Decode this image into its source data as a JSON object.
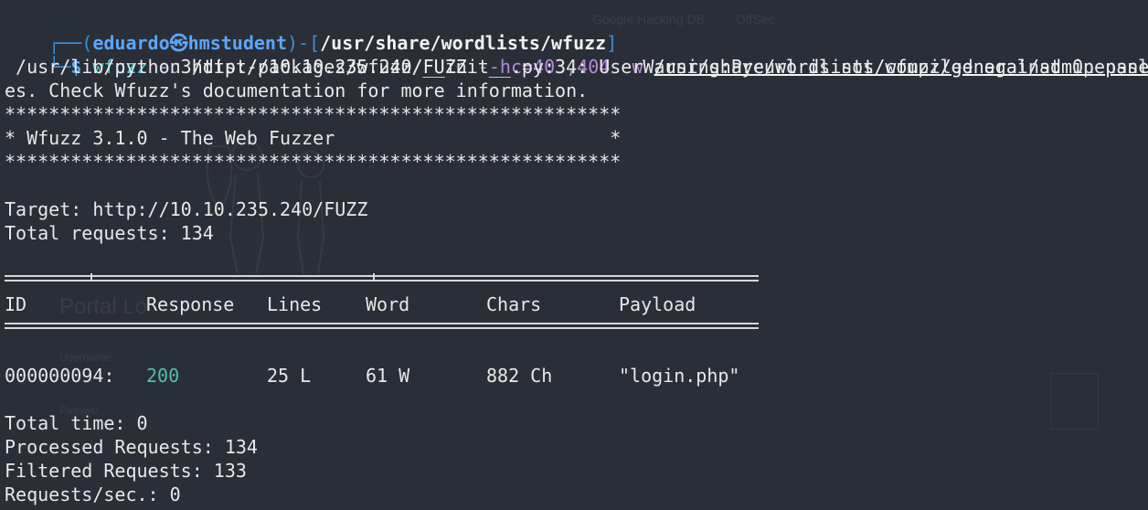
{
  "prompt": {
    "box_top": "┌──(",
    "user": "eduardo㉿hmstudent",
    "mid": ")-[",
    "path": "/usr/share/wordlists/wfuzz",
    "end": "]",
    "box_bottom": "└─",
    "dollar": "$"
  },
  "command": {
    "name": "wfuzz",
    "flag_u": "-u",
    "url": "http://10.10.235.240/FUZZ",
    "flag_hc": "--hc=403,404",
    "flag_w": "-w",
    "wordlist": "/usr/share/wordlists/wfuzz/general/admin-panels.t"
  },
  "warning": {
    "line1": " /usr/lib/python3/dist-packages/wfuzz/__init__.py:34: UserWarning:Pycurl is not compiled against Openssl",
    "line2": "es. Check Wfuzz's documentation for more information."
  },
  "banner": {
    "border": "********************************************************",
    "title": "* Wfuzz 3.1.0 - The Web Fuzzer                         *"
  },
  "target": {
    "target_line": "Target: http://10.10.235.240/FUZZ",
    "total_line": "Total requests: 134"
  },
  "table": {
    "headers": [
      "ID",
      "Response",
      "Lines",
      "Word",
      "Chars",
      "Payload"
    ],
    "rows": [
      {
        "id": "000000094:",
        "response": "200",
        "lines": "25 L",
        "word": "61 W",
        "chars": "882 Ch",
        "payload": "\"login.php\""
      }
    ]
  },
  "summary": {
    "total_time": "Total time: 0",
    "processed": "Processed Requests: 134",
    "filtered": "Filtered Requests: 133",
    "rate": "Requests/sec.: 0"
  },
  "background": {
    "tab_google": "Google Hacking DB",
    "tab_offsec": "OffSec",
    "portal_title": "Portal Lo",
    "username_label": "Username:",
    "password_label": "Passwo"
  },
  "colors": {
    "background": "#2a2e37",
    "prompt_blue": "#5ba7ff",
    "command_cyan": "#4fd1d9",
    "flag_purple": "#b48ad6",
    "status_green": "#4fbfa8"
  }
}
